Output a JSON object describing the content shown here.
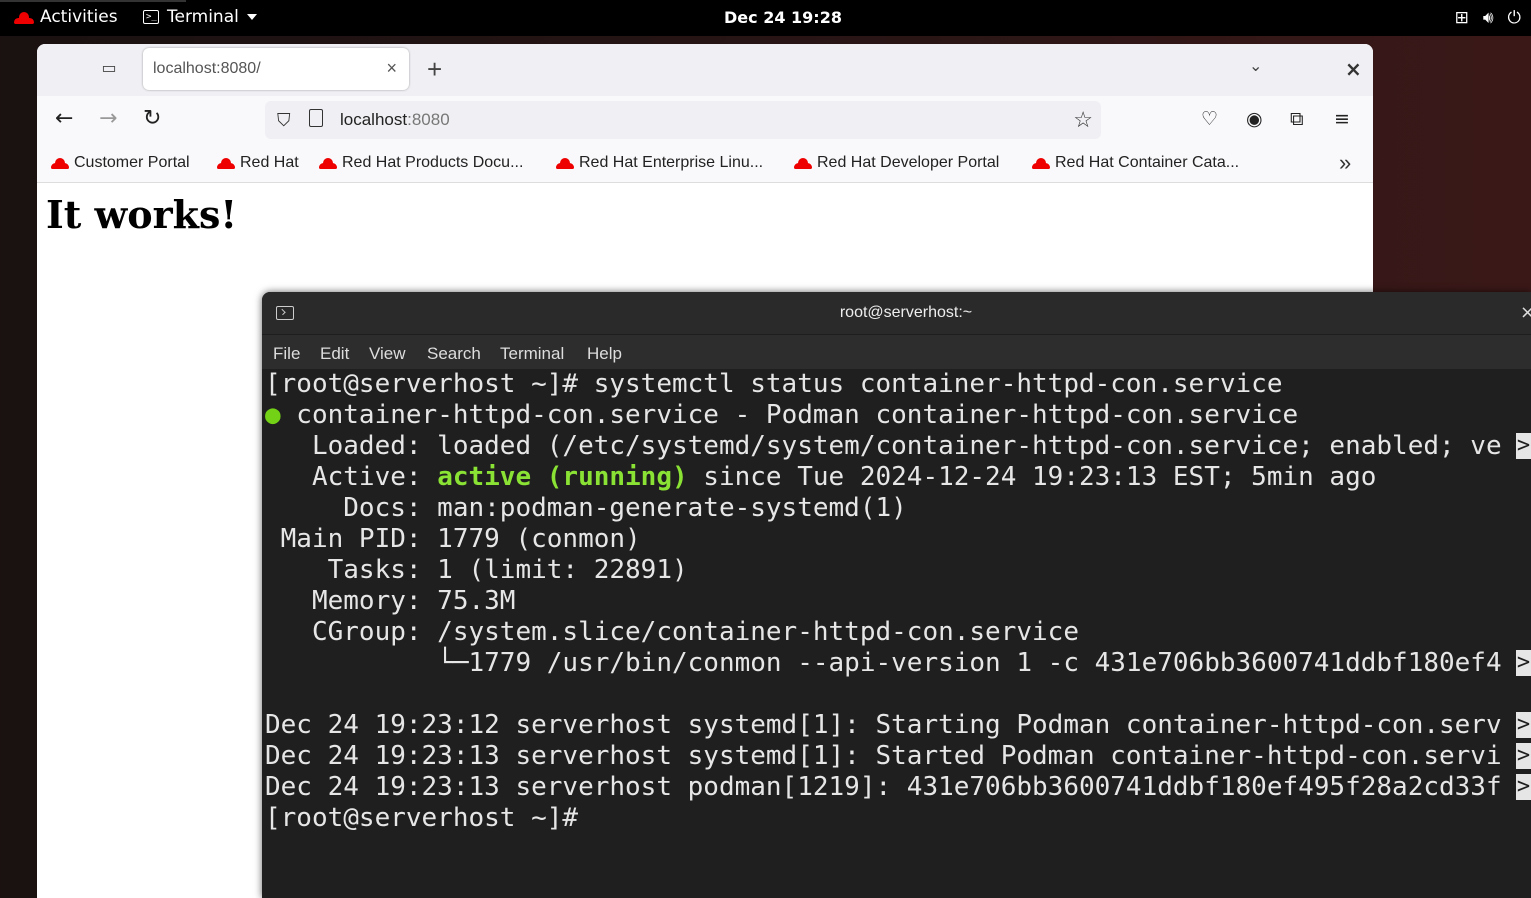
{
  "topbar": {
    "activities": "Activities",
    "app_name": "Terminal",
    "clock": "Dec 24  19:28"
  },
  "browser": {
    "tab_title": "localhost:8080/",
    "url_host": "localhost",
    "url_port": ":8080",
    "page_heading": "It works!",
    "bookmarks": [
      "Customer Portal",
      "Red Hat",
      "Red Hat Products Docu...",
      "Red Hat Enterprise Linu...",
      "Red Hat Developer Portal",
      "Red Hat Container Cata..."
    ]
  },
  "terminal": {
    "title": "root@serverhost:~",
    "menu": [
      "File",
      "Edit",
      "View",
      "Search",
      "Terminal",
      "Help"
    ],
    "lines": {
      "l0": "[root@serverhost ~]# systemctl status container-httpd-con.service",
      "l1_dot": "●",
      "l1": " container-httpd-con.service - Podman container-httpd-con.service",
      "l2": "   Loaded: loaded (/etc/systemd/system/container-httpd-con.service; enabled; ve",
      "l3_pre": "   Active: ",
      "l3_status": "active (running)",
      "l3_post": " since Tue 2024-12-24 19:23:13 EST; 5min ago",
      "l4": "     Docs: man:podman-generate-systemd(1)",
      "l5": " Main PID: 1779 (conmon)",
      "l6": "    Tasks: 1 (limit: 22891)",
      "l7": "   Memory: 75.3M",
      "l8": "   CGroup: /system.slice/container-httpd-con.service",
      "l9": "           └─1779 /usr/bin/conmon --api-version 1 -c 431e706bb3600741ddbf180ef4",
      "l11": "Dec 24 19:23:12 serverhost systemd[1]: Starting Podman container-httpd-con.serv",
      "l12": "Dec 24 19:23:13 serverhost systemd[1]: Started Podman container-httpd-con.servi",
      "l13": "Dec 24 19:23:13 serverhost podman[1219]: 431e706bb3600741ddbf180ef495f28a2cd33f",
      "l14": "[root@serverhost ~]# ",
      "trunc": ">"
    }
  }
}
